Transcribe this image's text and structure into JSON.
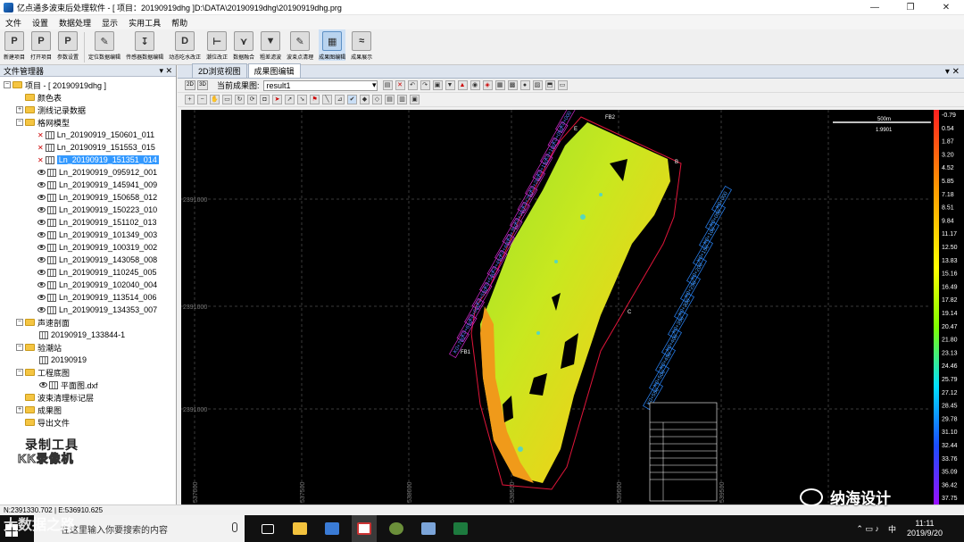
{
  "window": {
    "title": "亿点通多波束后处理软件 - [ 项目：20190919dhg ]D:\\DATA\\20190919dhg\\20190919dhg.prg",
    "minimize": "—",
    "maximize": "❐",
    "close": "✕"
  },
  "menu": [
    "文件",
    "设置",
    "数据处理",
    "显示",
    "实用工具",
    "帮助"
  ],
  "ribbon": [
    {
      "label": "新建项目",
      "icon": "P"
    },
    {
      "label": "打开项目",
      "icon": "P"
    },
    {
      "label": "参数设置",
      "icon": "P"
    },
    {
      "label": "定位数据编辑",
      "icon": "✎"
    },
    {
      "label": "传感器数据编辑",
      "icon": "↧"
    },
    {
      "label": "动态吃水改正",
      "icon": "D"
    },
    {
      "label": "潮位改正",
      "icon": "⊢"
    },
    {
      "label": "数据融合",
      "icon": "⋎"
    },
    {
      "label": "粗差滤波",
      "icon": "▼"
    },
    {
      "label": "波束点清理",
      "icon": "✎"
    },
    {
      "label": "成果图编辑",
      "icon": "▦"
    },
    {
      "label": "成果展示",
      "icon": "≈"
    }
  ],
  "file_manager": {
    "title": "文件管理器",
    "pin": "▾ ✕",
    "root": "项目 - [ 20190919dhg ]",
    "nodes": [
      "颜色表",
      "测线记录数据",
      "格网模型"
    ],
    "lines": [
      "Ln_20190919_150601_011",
      "Ln_20190919_151553_015",
      "Ln_20190919_151351_014",
      "Ln_20190919_095912_001",
      "Ln_20190919_145941_009",
      "Ln_20190919_150658_012",
      "Ln_20190919_150223_010",
      "Ln_20190919_151102_013",
      "Ln_20190919_101349_003",
      "Ln_20190919_100319_002",
      "Ln_20190919_143058_008",
      "Ln_20190919_110245_005",
      "Ln_20190919_102040_004",
      "Ln_20190919_113514_006",
      "Ln_20190919_134353_007"
    ],
    "sound": "声速剖面",
    "sound_child": "20190919_133844-1",
    "check": "验潮站",
    "check_child": "20190919",
    "eng": "工程底图",
    "eng_child": "平面图.dxf",
    "more": [
      "波束清理标记层",
      "成果图",
      "导出文件"
    ]
  },
  "watermark": {
    "line1": "录制工具",
    "line2": "KK录像机"
  },
  "tabs": {
    "tab1": "2D浏览视图",
    "tab2": "成果图编辑",
    "close": "▾ ✕"
  },
  "toolbar": {
    "mode2d": "2D",
    "mode3d": "3D",
    "current_label": "当前成果图:",
    "current_value": "result1"
  },
  "map": {
    "scale_label": "500m",
    "scale_ratio": "1:9901",
    "y_labels": [
      "2391000",
      "2391000",
      "2391000"
    ],
    "x_labels": [
      "537000",
      "537500",
      "538000",
      "538500",
      "539000",
      "539500"
    ],
    "legend": [
      "-0.79",
      "0.54",
      "1.87",
      "3.20",
      "4.52",
      "5.85",
      "7.18",
      "8.51",
      "9.84",
      "11.17",
      "12.50",
      "13.83",
      "15.16",
      "16.49",
      "17.82",
      "19.14",
      "20.47",
      "21.80",
      "23.13",
      "24.46",
      "25.79",
      "27.12",
      "28.45",
      "29.78",
      "31.10",
      "32.44",
      "33.76",
      "35.09",
      "36.42",
      "37.75"
    ],
    "marker_labels": [
      "FB2",
      "FB1",
      "C",
      "B",
      "E"
    ],
    "line_labels_left": [
      "K0+000",
      "K0+050",
      "K0+100",
      "K0+150",
      "K0+200",
      "K0+250",
      "K0+300",
      "K0+350",
      "K0+400",
      "K0+450",
      "K0+500",
      "K0+550",
      "K0+600",
      "K0+650",
      "K0+700"
    ],
    "line_labels_right": [
      "K0+000",
      "K0+050",
      "K0+100",
      "K0+150",
      "K0+200",
      "K0+250",
      "K0+300",
      "K0+350",
      "K0+400",
      "K0+450",
      "K0+500",
      "K0+550"
    ]
  },
  "status": {
    "coords": "N:2391330.702 | E:536910.625"
  },
  "brand": "纳海设计",
  "bottom_watermark": "大数据之路",
  "taskbar": {
    "search": "在这里输入你要搜索的内容",
    "time": "11:11",
    "date": "2019/9/20",
    "ime": "中"
  }
}
